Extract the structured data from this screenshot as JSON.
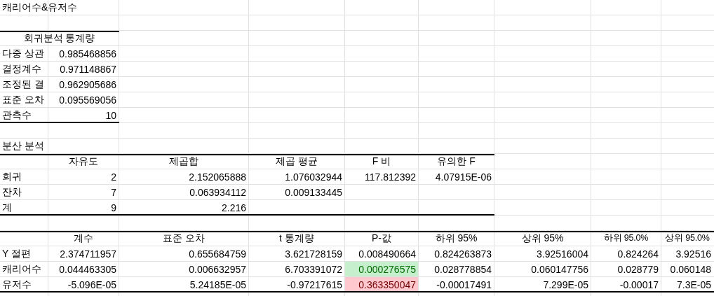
{
  "title": "캐리어수&유저수",
  "regression_stats": {
    "header": "회귀분석 통계량",
    "rows": [
      {
        "label": "다중 상관",
        "value": "0.985468856"
      },
      {
        "label": "결정계수",
        "value": "0.971148867"
      },
      {
        "label": "조정된 결",
        "value": "0.962905686"
      },
      {
        "label": "표준 오차",
        "value": "0.095569056"
      },
      {
        "label": "관측수",
        "value": "10"
      }
    ]
  },
  "anova": {
    "title": "분산 분석",
    "columns": [
      "자유도",
      "제곱합",
      "제곱 평균",
      "F 비",
      "유의한 F"
    ],
    "rows": [
      {
        "label": "회귀",
        "values": [
          "2",
          "2.152065888",
          "1.076032944",
          "117.812392",
          "4.07915E-06"
        ]
      },
      {
        "label": "잔차",
        "values": [
          "7",
          "0.063934112",
          "0.009133445"
        ]
      },
      {
        "label": "계",
        "values": [
          "9",
          "2.216"
        ]
      }
    ]
  },
  "coefficients": {
    "columns": [
      "계수",
      "표준 오차",
      "t 통계량",
      "P-값",
      "하위 95%",
      "상위 95%",
      "하위 95.0%",
      "상위 95.0%"
    ],
    "rows": [
      {
        "label": "Y 절편",
        "values": [
          "2.374711957",
          "0.655684759",
          "3.621728159",
          "0.008490664",
          "0.824263873",
          "3.92516004",
          "0.824264",
          "3.92516"
        ]
      },
      {
        "label": "캐리어수",
        "values": [
          "0.044463305",
          "0.006632957",
          "6.703391072",
          "0.000276575",
          "0.028778854",
          "0.060147756",
          "0.028779",
          "0.060148"
        ],
        "color": "#c6efce"
      },
      {
        "label": "유저수",
        "values": [
          "-5.096E-05",
          "5.24185E-05",
          "-0.97217615",
          "0.363350047",
          "-0.00017491",
          "7.299E-05",
          "-0.00017",
          "7.3E-05"
        ],
        "color": "#ffc7ce"
      }
    ]
  }
}
